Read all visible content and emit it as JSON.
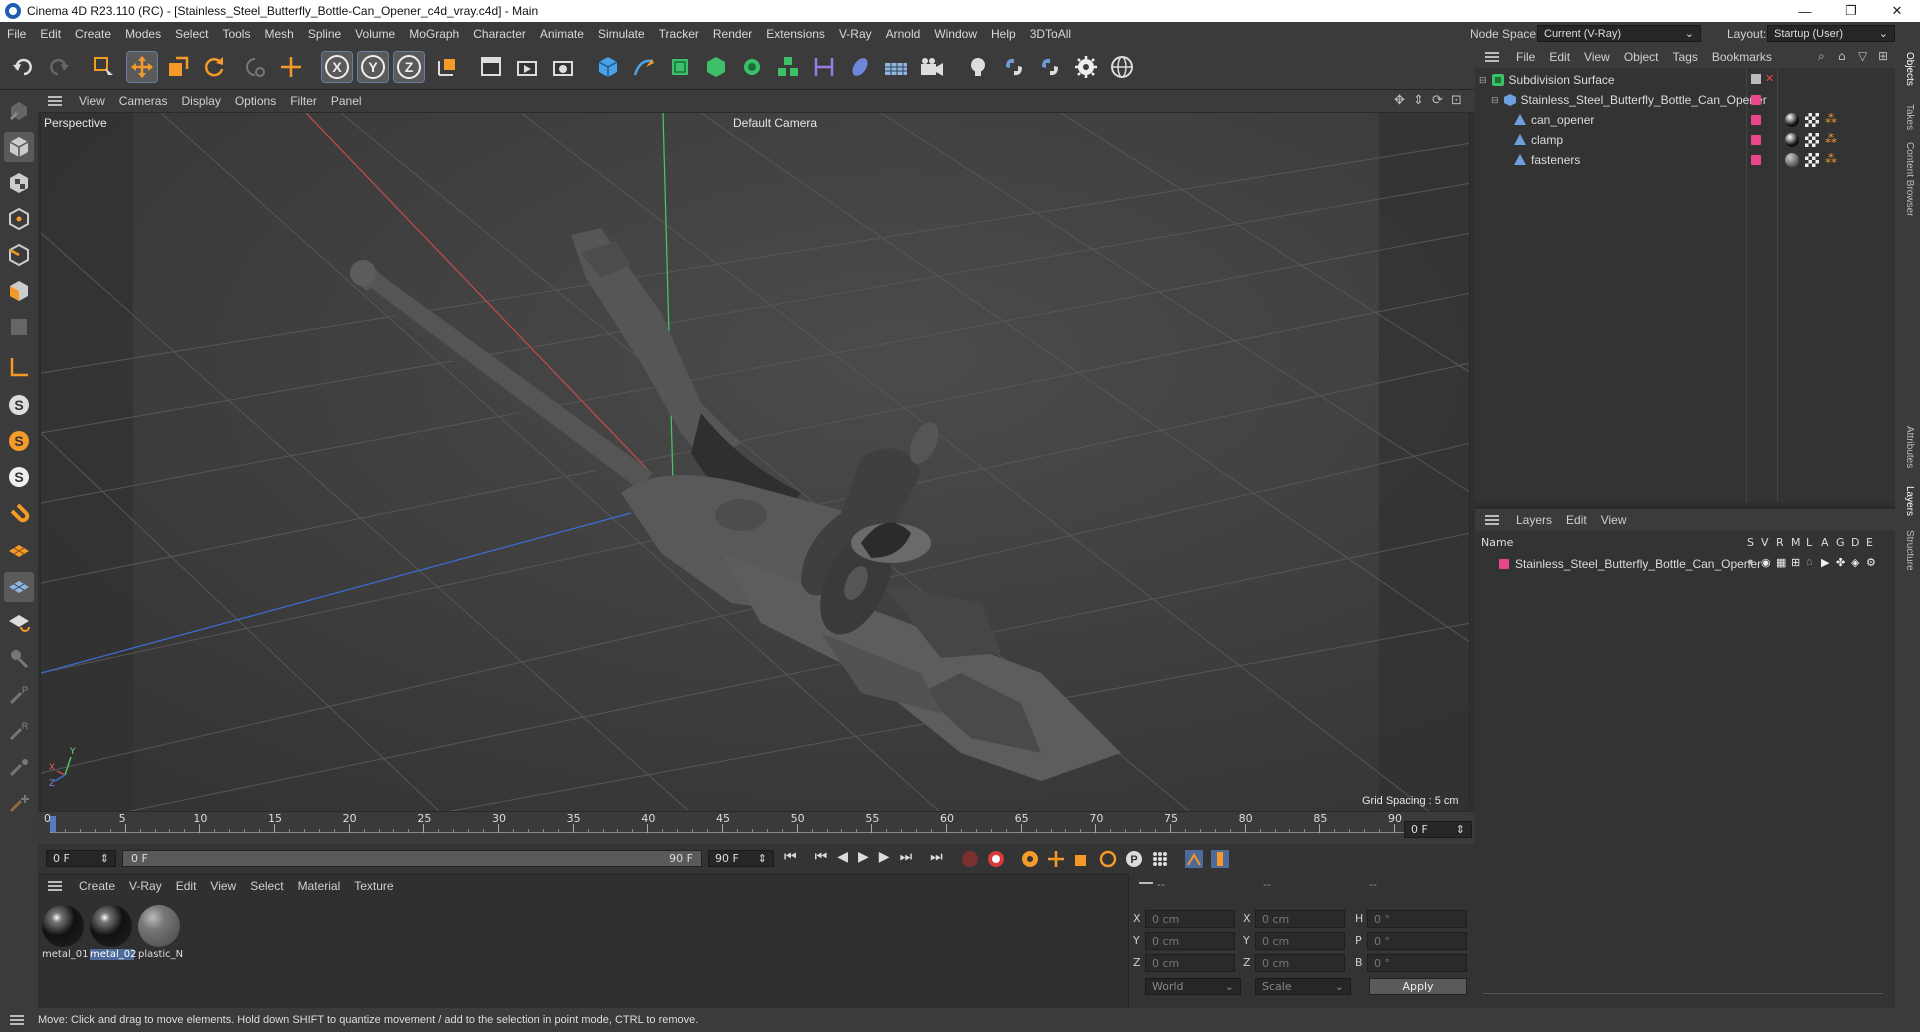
{
  "window": {
    "title": "Cinema 4D R23.110 (RC) - [Stainless_Steel_Butterfly_Bottle-Can_Opener_c4d_vray.c4d] - Main",
    "min": "—",
    "max": "❐",
    "close": "✕"
  },
  "menubar": {
    "items": [
      "File",
      "Edit",
      "Create",
      "Modes",
      "Select",
      "Tools",
      "Mesh",
      "Spline",
      "Volume",
      "MoGraph",
      "Character",
      "Animate",
      "Simulate",
      "Tracker",
      "Render",
      "Extensions",
      "V-Ray",
      "Arnold",
      "Window",
      "Help",
      "3DToAll"
    ],
    "node_space_label": "Node Space:",
    "node_space_value": "Current (V-Ray)",
    "layout_label": "Layout:",
    "layout_value": "Startup (User)"
  },
  "viewport": {
    "menu": [
      "View",
      "Cameras",
      "Display",
      "Options",
      "Filter",
      "Panel"
    ],
    "name": "Perspective",
    "camera": "Default Camera",
    "grid_spacing": "Grid Spacing : 5 cm",
    "axis_x": "X",
    "axis_y": "Y",
    "axis_z": "Z"
  },
  "timeline": {
    "ticks": [
      "0",
      "5",
      "10",
      "15",
      "20",
      "25",
      "30",
      "35",
      "40",
      "45",
      "50",
      "55",
      "60",
      "65",
      "70",
      "75",
      "80",
      "85",
      "90"
    ],
    "current_frame": "0 F",
    "start_field": "0 F",
    "range_start": "0 F",
    "range_end": "90 F",
    "end_field": "90 F"
  },
  "materials": {
    "menu": [
      "Create",
      "V-Ray",
      "Edit",
      "View",
      "Select",
      "Material",
      "Texture"
    ],
    "items": [
      {
        "label": "metal_01"
      },
      {
        "label": "metal_02"
      },
      {
        "label": "plastic_N"
      }
    ]
  },
  "coords": {
    "header_a": "--",
    "header_b": "--",
    "header_c": "--",
    "rows": [
      {
        "l1": "X",
        "v1": "0 cm",
        "l2": "X",
        "v2": "0 cm",
        "l3": "H",
        "v3": "0 °"
      },
      {
        "l1": "Y",
        "v1": "0 cm",
        "l2": "Y",
        "v2": "0 cm",
        "l3": "P",
        "v3": "0 °"
      },
      {
        "l1": "Z",
        "v1": "0 cm",
        "l2": "Z",
        "v2": "0 cm",
        "l3": "B",
        "v3": "0 °"
      }
    ],
    "space": "World",
    "mode": "Scale",
    "apply": "Apply"
  },
  "objects": {
    "menu": [
      "File",
      "Edit",
      "View",
      "Object",
      "Tags",
      "Bookmarks"
    ],
    "tree": [
      {
        "name": "Subdivision Surface"
      },
      {
        "name": "Stainless_Steel_Butterfly_Bottle_Can_Opener"
      },
      {
        "name": "can_opener"
      },
      {
        "name": "clamp"
      },
      {
        "name": "fasteners"
      }
    ]
  },
  "layers": {
    "menu": [
      "Layers",
      "Edit",
      "View"
    ],
    "col_name": "Name",
    "cols": [
      "S",
      "V",
      "R",
      "M",
      "L",
      "A",
      "G",
      "D",
      "E"
    ],
    "rows": [
      {
        "name": "Stainless_Steel_Butterfly_Bottle_Can_Opener"
      }
    ]
  },
  "side_tabs": [
    "Objects",
    "Takes",
    "Content Browser",
    "Attributes",
    "Layers",
    "Structure"
  ],
  "status": "Move: Click and drag to move elements. Hold down SHIFT to quantize movement / add to the selection in point mode, CTRL to remove.",
  "colors": {
    "accent": "#e8488a",
    "selection": "#4d6a9a"
  }
}
